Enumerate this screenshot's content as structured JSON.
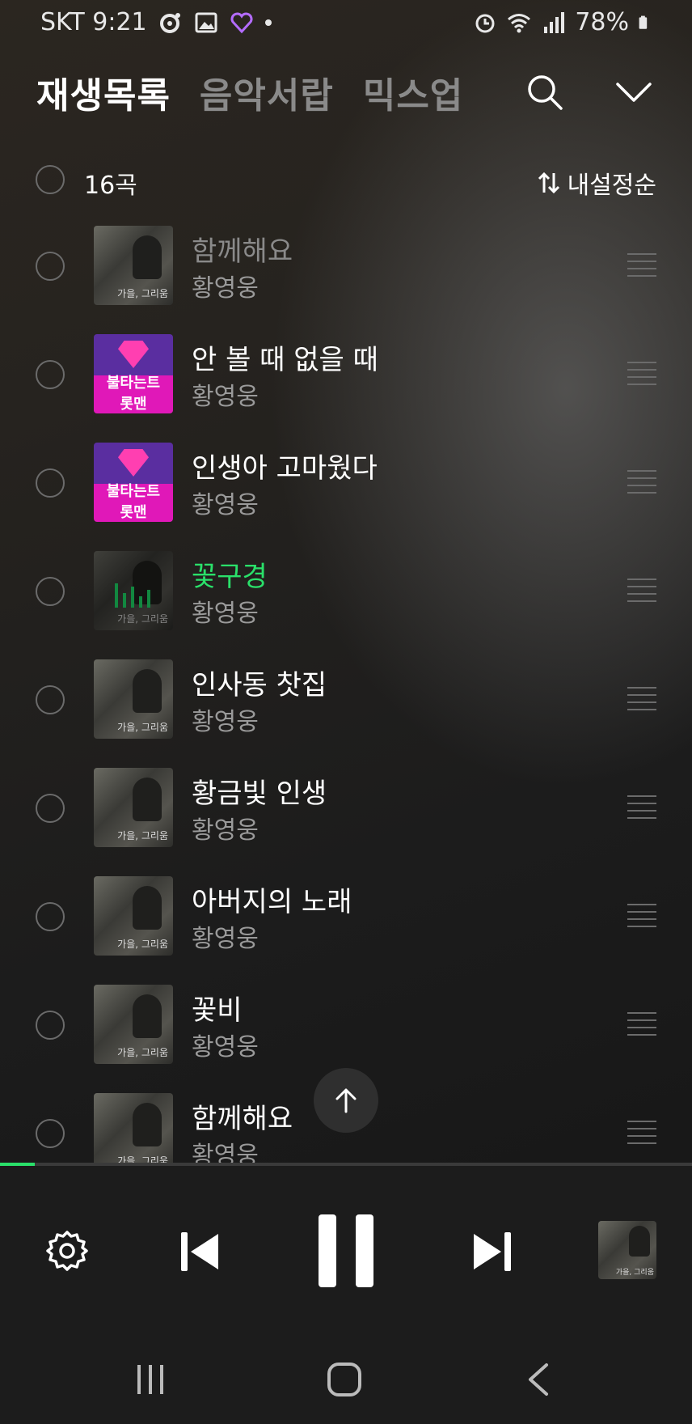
{
  "status_bar": {
    "carrier_time": "SKT 9:21",
    "battery": "78%"
  },
  "tabs": [
    {
      "label": "재생목록",
      "active": true
    },
    {
      "label": "음악서랍",
      "active": false
    },
    {
      "label": "믹스업",
      "active": false
    }
  ],
  "list_header": {
    "count": "16곡",
    "sort_label": "내설정순"
  },
  "tracks": [
    {
      "title": "함께해요",
      "artist": "황영웅",
      "art": "photo",
      "state": "dim"
    },
    {
      "title": "안 볼 때 없을 때",
      "artist": "황영웅",
      "art": "tv",
      "state": "normal"
    },
    {
      "title": "인생아 고마웠다",
      "artist": "황영웅",
      "art": "tv",
      "state": "normal"
    },
    {
      "title": "꽃구경",
      "artist": "황영웅",
      "art": "photo",
      "state": "playing"
    },
    {
      "title": "인사동 찻집",
      "artist": "황영웅",
      "art": "photo",
      "state": "normal"
    },
    {
      "title": "황금빛 인생",
      "artist": "황영웅",
      "art": "photo",
      "state": "normal"
    },
    {
      "title": "아버지의 노래",
      "artist": "황영웅",
      "art": "photo",
      "state": "normal"
    },
    {
      "title": "꽃비",
      "artist": "황영웅",
      "art": "photo",
      "state": "normal"
    },
    {
      "title": "함께해요",
      "artist": "황영웅",
      "art": "photo",
      "state": "normal"
    }
  ],
  "album_captions": {
    "photo": "가을, 그리움",
    "tv_logo": "불타는트롯맨"
  },
  "player": {
    "progress_fraction": 0.05
  },
  "colors": {
    "accent_green": "#2ae06a",
    "muted_text": "#9a9a9a"
  }
}
